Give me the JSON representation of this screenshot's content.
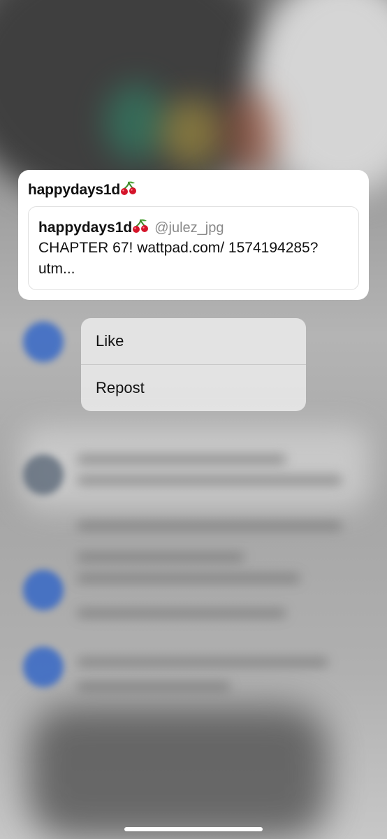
{
  "preview": {
    "author_name": "happydays1d",
    "quoted": {
      "name": "happydays1d",
      "handle": "@julez_jpg",
      "text": "CHAPTER 67! wattpad.com/ 1574194285?utm..."
    }
  },
  "menu": {
    "items": [
      {
        "label": "Like"
      },
      {
        "label": "Repost"
      }
    ]
  },
  "icons": {
    "author_emoji": "cherry-icon",
    "quoted_emoji": "cherry-icon"
  },
  "colors": {
    "cherry_red": "#d4142a",
    "handle_gray": "#8a8a8a",
    "menu_background": "#e6e6e6"
  }
}
